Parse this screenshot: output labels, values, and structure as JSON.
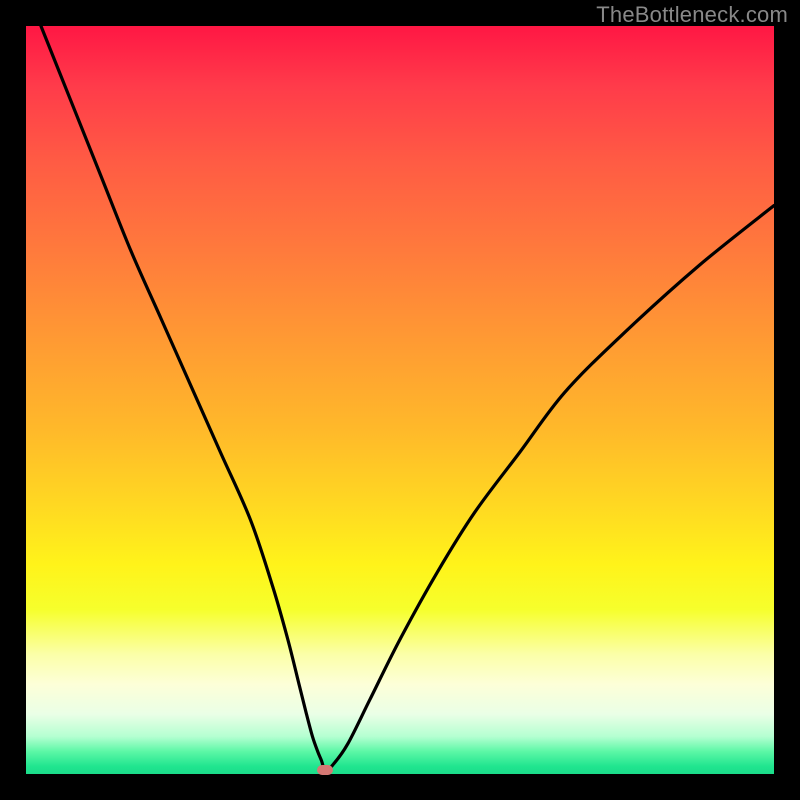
{
  "watermark": "TheBottleneck.com",
  "colors": {
    "frame": "#000000",
    "curve": "#000000",
    "marker": "#d57874",
    "watermark": "#888888"
  },
  "chart_data": {
    "type": "line",
    "title": "",
    "xlabel": "",
    "ylabel": "",
    "xlim": [
      0,
      100
    ],
    "ylim": [
      0,
      100
    ],
    "grid": false,
    "series": [
      {
        "name": "bottleneck-curve",
        "x": [
          2,
          6,
          10,
          14,
          18,
          22,
          26,
          30,
          33,
          35,
          36.5,
          37.5,
          38.3,
          39,
          39.5,
          40,
          41,
          43,
          46,
          50,
          55,
          60,
          66,
          72,
          80,
          90,
          100
        ],
        "y": [
          100,
          90,
          80,
          70,
          61,
          52,
          43,
          34,
          25,
          18,
          12,
          8,
          5,
          3,
          1.8,
          0.5,
          1.2,
          4,
          10,
          18,
          27,
          35,
          43,
          51,
          59,
          68,
          76
        ]
      }
    ],
    "marker": {
      "x": 40,
      "y": 0.5
    },
    "gradient_stops": [
      {
        "pos": 0,
        "color": "#ff1744"
      },
      {
        "pos": 18,
        "color": "#ff5b44"
      },
      {
        "pos": 42,
        "color": "#ff9a33"
      },
      {
        "pos": 64,
        "color": "#ffd822"
      },
      {
        "pos": 84,
        "color": "#fbffa8"
      },
      {
        "pos": 95,
        "color": "#b4ffd1"
      },
      {
        "pos": 100,
        "color": "#1bdc8a"
      }
    ]
  }
}
